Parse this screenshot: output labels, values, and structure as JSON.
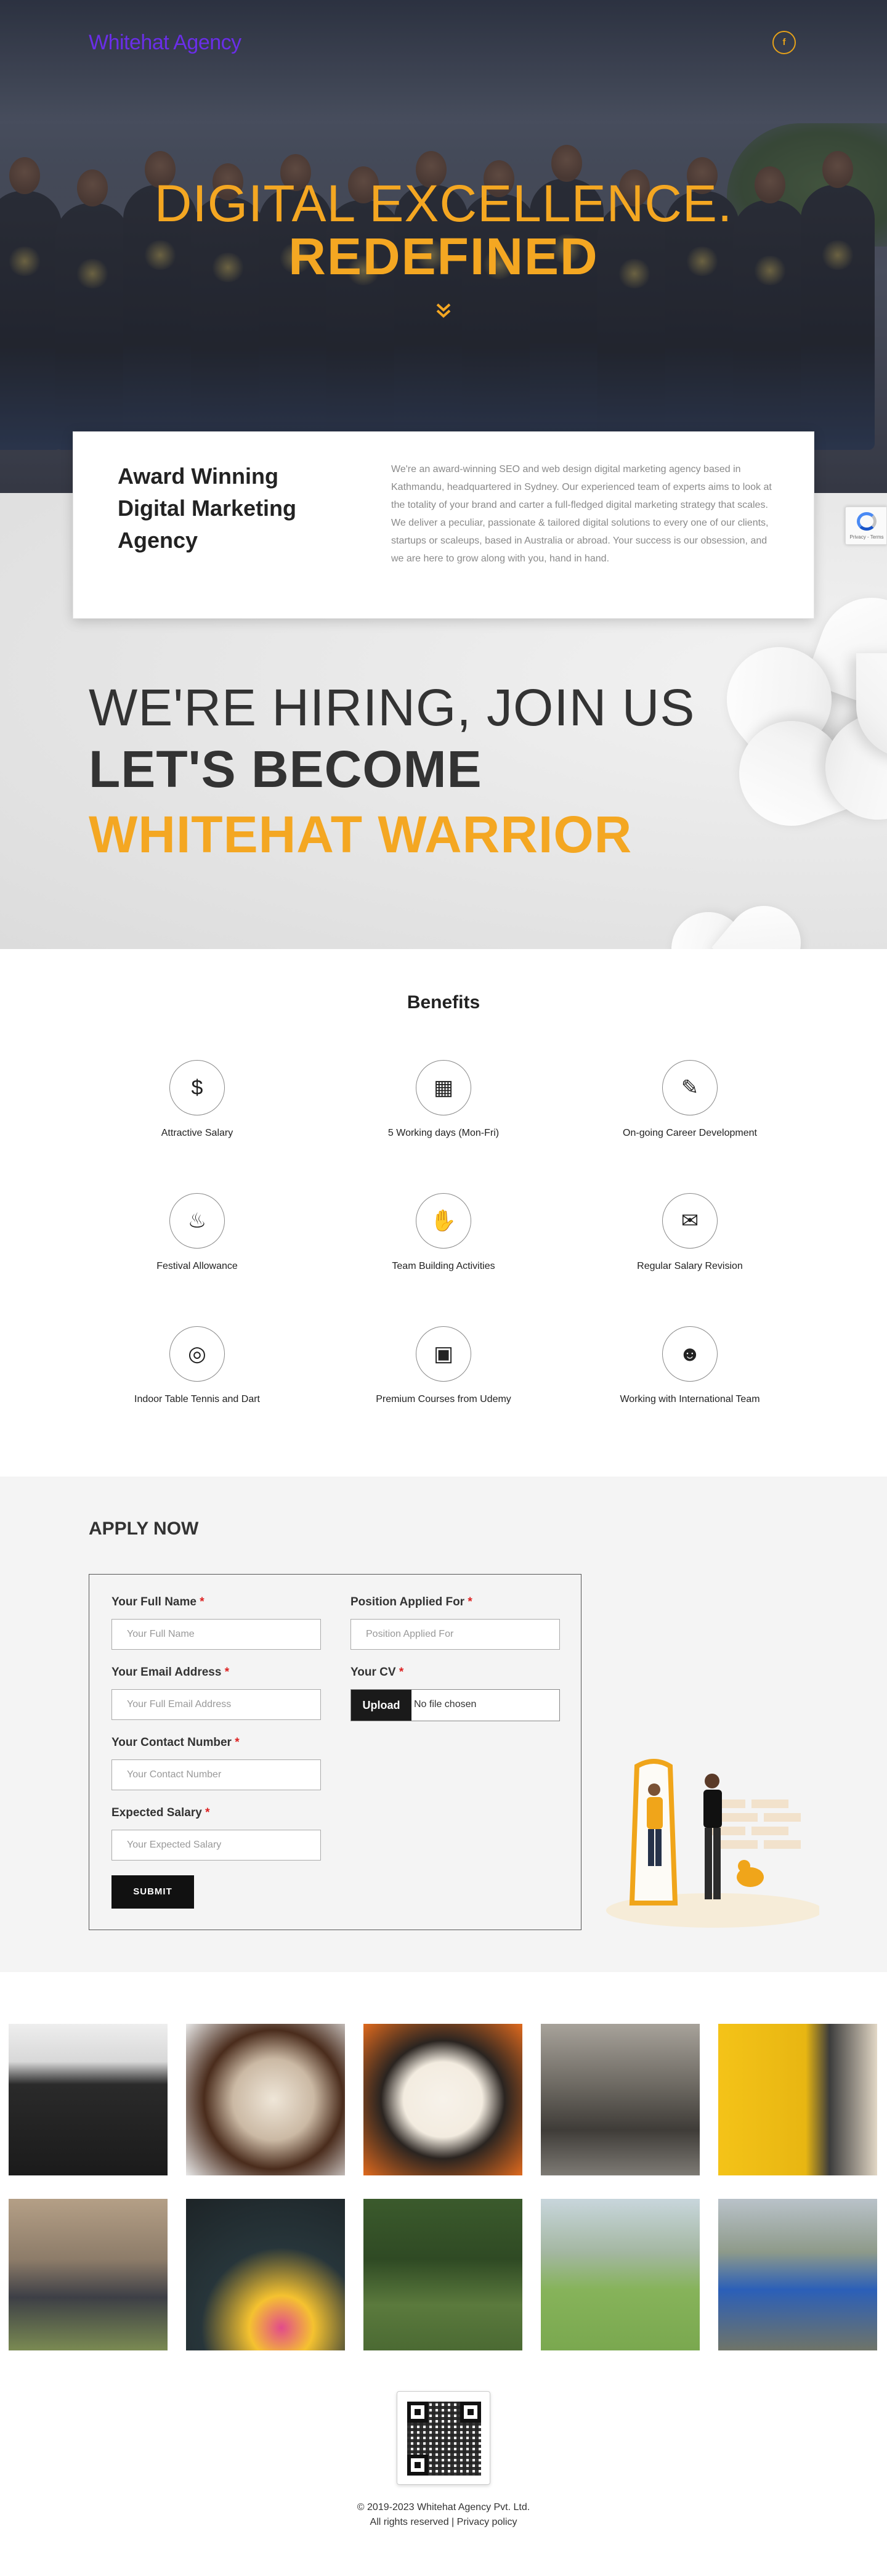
{
  "header": {
    "logo": "Whitehat Agency",
    "social_icon": "facebook-icon",
    "social_glyph": "f"
  },
  "hero": {
    "line1": "DIGITAL EXCELLENCE.",
    "line2": "REDEFINED",
    "scroll_icon": "chevron-double-down-icon",
    "accent_color": "#f4a722"
  },
  "award": {
    "title": "Award Winning Digital Marketing Agency",
    "text": "We're an award-winning SEO and web design digital marketing agency based in Kathmandu, headquartered in Sydney. Our experienced team of experts aims to look at the totality of your brand and carter a full-fledged digital marketing strategy that scales. We deliver a peculiar, passionate & tailored digital solutions to every one of our clients, startups or scaleups, based in Australia or abroad. Your success is our obsession, and we are here to grow along with you, hand in hand."
  },
  "recaptcha": {
    "text": "Privacy - Terms"
  },
  "hiring": {
    "line1": "WE'RE HIRING, JOIN US",
    "line2": "LET'S BECOME",
    "line3": "WHITEHAT WARRIOR"
  },
  "benefits": {
    "title": "Benefits",
    "items": [
      {
        "label": "Attractive Salary",
        "icon": "salary-icon",
        "glyph": "$"
      },
      {
        "label": "5 Working days (Mon-Fri)",
        "icon": "calendar-icon",
        "glyph": "▦"
      },
      {
        "label": "On-going Career Development",
        "icon": "career-icon",
        "glyph": "✎"
      },
      {
        "label": "Festival Allowance",
        "icon": "diya-lamp-icon",
        "glyph": "♨"
      },
      {
        "label": "Team Building Activities",
        "icon": "handshake-icon",
        "glyph": "✋"
      },
      {
        "label": "Regular Salary Revision",
        "icon": "salary-revision-icon",
        "glyph": "✉"
      },
      {
        "label": "Indoor Table Tennis and Dart",
        "icon": "dartboard-icon",
        "glyph": "◎"
      },
      {
        "label": "Premium Courses from Udemy",
        "icon": "course-icon",
        "glyph": "▣"
      },
      {
        "label": "Working with International Team",
        "icon": "team-icon",
        "glyph": "☻"
      }
    ]
  },
  "apply": {
    "title": "APPLY NOW",
    "full_name_label": "Your Full Name",
    "full_name_placeholder": "Your Full Name",
    "email_label": "Your Email Address",
    "email_placeholder": "Your Full Email Address",
    "contact_label": "Your Contact Number",
    "contact_placeholder": "Your Contact Number",
    "salary_label": "Expected Salary",
    "salary_placeholder": "Your Expected Salary",
    "position_label": "Position Applied For",
    "position_placeholder": "Position Applied For",
    "cv_label": "Your CV",
    "upload_label": "Upload",
    "no_file_text": "No file chosen",
    "required_mark": "*",
    "submit_label": "SUBMIT"
  },
  "footer": {
    "copyright": "© 2019-2023 Whitehat Agency Pvt. Ltd.",
    "rights_and_policy": "All rights reserved | Privacy policy"
  }
}
